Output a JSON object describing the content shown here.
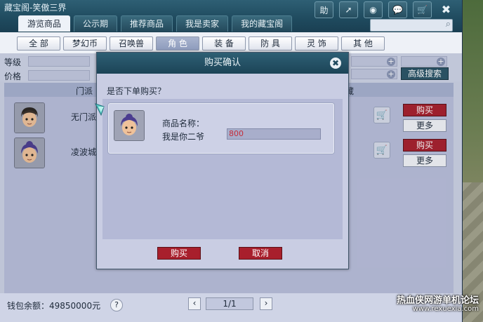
{
  "window": {
    "title": "藏宝阁-笑傲三界"
  },
  "titlebar_icons": [
    {
      "name": "help-icon",
      "glyph": "助"
    },
    {
      "name": "share-icon",
      "glyph": "➚"
    },
    {
      "name": "stop-icon",
      "glyph": "◉"
    },
    {
      "name": "chat-icon",
      "glyph": "💬"
    },
    {
      "name": "cart-icon",
      "glyph": "🛒"
    },
    {
      "name": "close-icon",
      "glyph": "✖"
    }
  ],
  "tabs": [
    {
      "label": "游览商品"
    },
    {
      "label": "公示期"
    },
    {
      "label": "推荐商品"
    },
    {
      "label": "我是卖家"
    },
    {
      "label": "我的藏宝阁"
    }
  ],
  "categories": [
    {
      "label": "全 部"
    },
    {
      "label": "梦幻币"
    },
    {
      "label": "召唤兽"
    },
    {
      "label": "角 色"
    },
    {
      "label": "装 备"
    },
    {
      "label": "防 具"
    },
    {
      "label": "灵 饰"
    },
    {
      "label": "其 他"
    }
  ],
  "filters": {
    "level_label": "等级",
    "price_label": "价格",
    "dash": "–",
    "advanced_search": "高级搜索"
  },
  "table": {
    "headers": [
      "门派",
      "藏"
    ],
    "rows": [
      {
        "school": "无门派",
        "buy": "购买",
        "more": "更多"
      },
      {
        "school": "凌波城",
        "buy": "购买",
        "more": "更多"
      }
    ]
  },
  "footer": {
    "balance": "钱包余额：49850000元",
    "help": "?",
    "prev": "‹",
    "next": "›",
    "page": "1/1"
  },
  "modal": {
    "title": "购买确认",
    "close": "✖",
    "question": "是否下单购买？",
    "item_label": "商品名称：",
    "item_name": "我是你二爷",
    "price": "800",
    "buy": "购买",
    "cancel": "取消"
  },
  "watermark": {
    "line1": "热血侠网游单机论坛",
    "line2": "www.rexuexia.com"
  },
  "colors": {
    "titlebar": "#1f4a5e",
    "buy_red": "#a81f2c",
    "panel": "#cdd2e4"
  }
}
